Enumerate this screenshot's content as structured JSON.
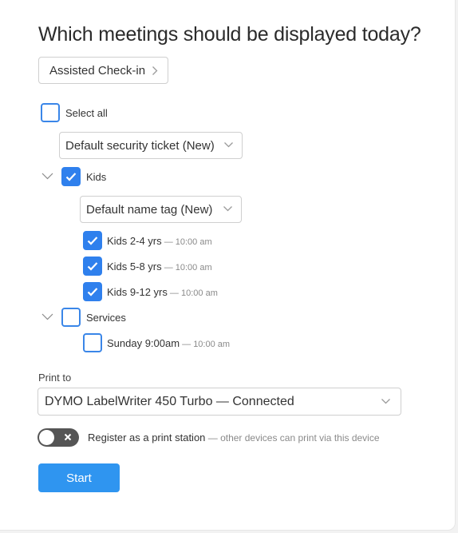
{
  "page": {
    "title": "Which meetings should be displayed today?",
    "mode_button": "Assisted Check-in"
  },
  "select_all": {
    "label": "Select all",
    "checked": false
  },
  "default_ticket": {
    "value": "Default security ticket (New)"
  },
  "groups": [
    {
      "label": "Kids",
      "checked": true,
      "expanded": true,
      "name_tag": "Default name tag (New)",
      "items": [
        {
          "label": "Kids 2-4 yrs",
          "time": " — 10:00 am",
          "checked": true
        },
        {
          "label": "Kids 5-8 yrs",
          "time": " — 10:00 am",
          "checked": true
        },
        {
          "label": "Kids 9-12 yrs",
          "time": " — 10:00 am",
          "checked": true
        }
      ]
    },
    {
      "label": "Services",
      "checked": false,
      "expanded": true,
      "items": [
        {
          "label": "Sunday 9:00am",
          "time": " — 10:00 am",
          "checked": false
        }
      ]
    }
  ],
  "print": {
    "label": "Print to",
    "printer": "DYMO LabelWriter 450 Turbo — Connected"
  },
  "print_station": {
    "enabled": false,
    "label": "Register as a print station",
    "hint": " — other devices can print via this device"
  },
  "start_label": "Start",
  "colors": {
    "accent": "#2f80ed",
    "button": "#2f95f0",
    "toggle_off": "#555555"
  },
  "icons": {
    "chevron": "chevron-right-icon",
    "dropdown": "chevron-down-icon",
    "check": "checkmark-icon",
    "toggle_x": "close-icon"
  }
}
